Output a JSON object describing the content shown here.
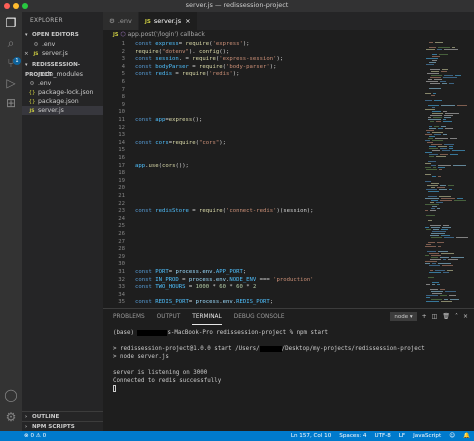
{
  "window": {
    "title": "server.js — redissession-project"
  },
  "activity": {
    "badge": "1"
  },
  "sidebar": {
    "header": "EXPLORER",
    "open_editors_title": "OPEN EDITORS",
    "open_editors": [
      {
        "icon": "⚙",
        "name": ".env"
      },
      {
        "icon": "JS",
        "name": "server.js"
      }
    ],
    "project_title": "REDISSESSION-PROJECT",
    "files": [
      {
        "icon": "›",
        "name": "node_modules"
      },
      {
        "icon": "⚙",
        "name": ".env"
      },
      {
        "icon": "{}",
        "name": "package-lock.json"
      },
      {
        "icon": "{}",
        "name": "package.json"
      },
      {
        "icon": "JS",
        "name": "server.js"
      }
    ],
    "outline_title": "OUTLINE",
    "npm_title": "NPM SCRIPTS"
  },
  "tabs": [
    {
      "icon": "⚙",
      "label": ".env"
    },
    {
      "icon": "JS",
      "label": "server.js",
      "close": "×"
    }
  ],
  "breadcrumb": {
    "file_icon": "JS",
    "path": "app.post('/login') callback"
  },
  "editor": {
    "lines": [
      {
        "n": "1",
        "tokens": [
          [
            "kw",
            "const "
          ],
          [
            "var",
            "express"
          ],
          [
            "",
            "= "
          ],
          [
            "fn",
            "require"
          ],
          [
            "",
            "("
          ],
          [
            "str",
            "'express'"
          ],
          [
            "",
            ");"
          ]
        ]
      },
      {
        "n": "2",
        "tokens": [
          [
            "fn",
            "require"
          ],
          [
            "",
            "("
          ],
          [
            "str",
            "\"dotenv\""
          ],
          [
            "",
            "). "
          ],
          [
            "fn",
            "config"
          ],
          [
            "",
            "();"
          ]
        ]
      },
      {
        "n": "3",
        "tokens": [
          [
            "kw",
            "const "
          ],
          [
            "var",
            "session"
          ],
          [
            "",
            ". = "
          ],
          [
            "fn",
            "require"
          ],
          [
            "",
            "("
          ],
          [
            "str",
            "'express-session'"
          ],
          [
            "",
            ");"
          ]
        ]
      },
      {
        "n": "4",
        "tokens": [
          [
            "kw",
            "const "
          ],
          [
            "var",
            "bodyParser"
          ],
          [
            "",
            " = "
          ],
          [
            "fn",
            "require"
          ],
          [
            "",
            "("
          ],
          [
            "str",
            "'body-parser'"
          ],
          [
            "",
            ");"
          ]
        ]
      },
      {
        "n": "5",
        "tokens": [
          [
            "kw",
            "const "
          ],
          [
            "var",
            "redis"
          ],
          [
            "",
            " = "
          ],
          [
            "fn",
            "require"
          ],
          [
            "",
            "("
          ],
          [
            "str",
            "'redis'"
          ],
          [
            "",
            ");"
          ]
        ]
      },
      {
        "n": "6",
        "tokens": []
      },
      {
        "n": "7",
        "tokens": []
      },
      {
        "n": "8",
        "tokens": []
      },
      {
        "n": "9",
        "tokens": []
      },
      {
        "n": "10",
        "tokens": []
      },
      {
        "n": "11",
        "tokens": [
          [
            "kw",
            "const "
          ],
          [
            "var",
            "app"
          ],
          [
            "",
            "="
          ],
          [
            "fn",
            "express"
          ],
          [
            "",
            "();"
          ]
        ]
      },
      {
        "n": "12",
        "tokens": []
      },
      {
        "n": "13",
        "tokens": []
      },
      {
        "n": "14",
        "tokens": [
          [
            "kw",
            "const "
          ],
          [
            "var",
            "cors"
          ],
          [
            "",
            "="
          ],
          [
            "fn",
            "require"
          ],
          [
            "",
            "("
          ],
          [
            "str",
            "\"cors\""
          ],
          [
            "",
            ");"
          ]
        ]
      },
      {
        "n": "15",
        "tokens": []
      },
      {
        "n": "16",
        "tokens": []
      },
      {
        "n": "17",
        "tokens": [
          [
            "var",
            "app"
          ],
          [
            "",
            "."
          ],
          [
            "fn",
            "use"
          ],
          [
            "",
            "("
          ],
          [
            "fn",
            "cors"
          ],
          [
            "",
            "());"
          ]
        ]
      },
      {
        "n": "18",
        "tokens": []
      },
      {
        "n": "19",
        "tokens": []
      },
      {
        "n": "20",
        "tokens": []
      },
      {
        "n": "21",
        "tokens": []
      },
      {
        "n": "22",
        "tokens": []
      },
      {
        "n": "23",
        "tokens": [
          [
            "kw",
            "const "
          ],
          [
            "var",
            "redisStore"
          ],
          [
            "",
            " = "
          ],
          [
            "fn",
            "require"
          ],
          [
            "",
            "("
          ],
          [
            "str",
            "'connect-redis'"
          ],
          [
            "",
            ")(session);"
          ]
        ]
      },
      {
        "n": "24",
        "tokens": []
      },
      {
        "n": "25",
        "tokens": []
      },
      {
        "n": "26",
        "tokens": []
      },
      {
        "n": "27",
        "tokens": []
      },
      {
        "n": "28",
        "tokens": []
      },
      {
        "n": "29",
        "tokens": []
      },
      {
        "n": "30",
        "tokens": []
      },
      {
        "n": "31",
        "tokens": [
          [
            "kw",
            "const "
          ],
          [
            "var",
            "PORT"
          ],
          [
            "",
            "= "
          ],
          [
            "prop",
            "process"
          ],
          [
            "",
            "."
          ],
          [
            "prop",
            "env"
          ],
          [
            "",
            "."
          ],
          [
            "var",
            "APP_PORT"
          ],
          [
            "",
            ";"
          ]
        ]
      },
      {
        "n": "32",
        "tokens": [
          [
            "kw",
            "const "
          ],
          [
            "var",
            "IN_PROD"
          ],
          [
            "",
            " = "
          ],
          [
            "prop",
            "process"
          ],
          [
            "",
            "."
          ],
          [
            "prop",
            "env"
          ],
          [
            "",
            "."
          ],
          [
            "var",
            "NODE_ENV"
          ],
          [
            "",
            " === "
          ],
          [
            "str",
            "'production'"
          ]
        ]
      },
      {
        "n": "33",
        "tokens": [
          [
            "kw",
            "const "
          ],
          [
            "var",
            "TWO_HOURS"
          ],
          [
            "",
            " = "
          ],
          [
            "num",
            "1000"
          ],
          [
            "",
            " * "
          ],
          [
            "num",
            "60"
          ],
          [
            "",
            " * "
          ],
          [
            "num",
            "60"
          ],
          [
            "",
            " * "
          ],
          [
            "num",
            "2"
          ]
        ]
      },
      {
        "n": "34",
        "tokens": []
      },
      {
        "n": "35",
        "tokens": [
          [
            "kw",
            "const "
          ],
          [
            "var",
            "REDIS_PORT"
          ],
          [
            "",
            "= "
          ],
          [
            "prop",
            "process"
          ],
          [
            "",
            "."
          ],
          [
            "prop",
            "env"
          ],
          [
            "",
            "."
          ],
          [
            "var",
            "REDIS_PORT"
          ],
          [
            "",
            ";"
          ]
        ]
      }
    ]
  },
  "panel": {
    "tabs": [
      "PROBLEMS",
      "OUTPUT",
      "TERMINAL",
      "DEBUG CONSOLE"
    ],
    "active_tab": "TERMINAL",
    "terminal_select": "node",
    "terminal_lines": [
      {
        "a": "(base) ",
        "redact": true,
        "b": "s-MacBook-Pro redissession-project % npm start"
      },
      {
        "a": ""
      },
      {
        "a": "> redissession-project@1.0.0 start /Users/",
        "redact_sm": true,
        "b": "/Desktop/my-projects/redissession-project"
      },
      {
        "a": "> node server.js"
      },
      {
        "a": ""
      },
      {
        "a": "server is listening on 3000"
      },
      {
        "a": "Connected to redis successfully"
      }
    ]
  },
  "statusbar": {
    "left": "⊗ 0  ⚠ 0",
    "items": [
      "Ln 157, Col 10",
      "Spaces: 4",
      "UTF-8",
      "LF",
      "JavaScript",
      "☺",
      "🔔"
    ]
  },
  "colors": {
    "accent": "#007acc",
    "editor_bg": "#1e1e1e",
    "sidebar_bg": "#252526"
  }
}
